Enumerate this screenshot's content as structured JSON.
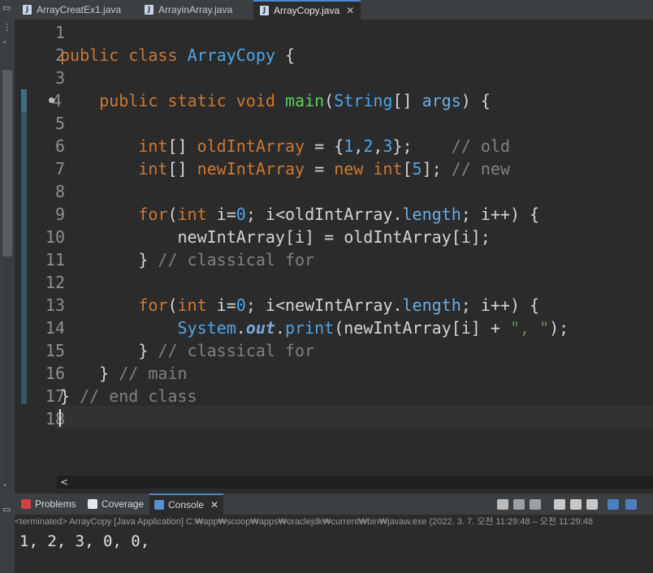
{
  "tabs": [
    {
      "label": "ArrayCreatEx1.java",
      "icon": "java-file-icon",
      "active": false
    },
    {
      "label": "ArrayinArray.java",
      "icon": "java-file-icon",
      "active": false
    },
    {
      "label": "ArrayCopy.java",
      "icon": "java-file-icon",
      "active": true,
      "close": "✕"
    }
  ],
  "editor": {
    "line_numbers": [
      "1",
      "2",
      "3",
      "4",
      "5",
      "6",
      "7",
      "8",
      "9",
      "10",
      "11",
      "12",
      "13",
      "14",
      "15",
      "16",
      "17",
      "18"
    ],
    "lines": {
      "l2": {
        "kw1": "public",
        "kw2": "class",
        "name": "ArrayCopy",
        "brace": "{"
      },
      "l4": {
        "kw1": "public",
        "kw2": "static",
        "kw3": "void",
        "fn": "main",
        "p1": "(",
        "type": "String",
        "arr": "[]",
        "arg": "args",
        "p2": ")",
        "brace": "{"
      },
      "l6": {
        "type": "int",
        "arr": "[]",
        "name": "oldIntArray",
        "eq": "=",
        "lb": "{",
        "n1": "1",
        "c1": ",",
        "n2": "2",
        "c2": ",",
        "n3": "3",
        "rb": "};",
        "comment": "// old"
      },
      "l7": {
        "type": "int",
        "arr": "[]",
        "name": "newIntArray",
        "eq": "=",
        "kw": "new",
        "type2": "int",
        "lbr": "[",
        "n": "5",
        "rbr": "];",
        "comment": "// new"
      },
      "l9": {
        "kw": "for",
        "p1": "(",
        "type": "int",
        "v": "i",
        "eq": "=",
        "n0": "0",
        "semi": ";",
        "cond1": "i<oldIntArray.",
        "field": "length",
        "semi2": ";",
        "inc": "i++",
        "p2": ")",
        "brace": "{"
      },
      "l10": {
        "text": "newIntArray[i] = oldIntArray[i];"
      },
      "l11": {
        "brace": "}",
        "comment": "// classical for"
      },
      "l13": {
        "kw": "for",
        "p1": "(",
        "type": "int",
        "v": "i",
        "eq": "=",
        "n0": "0",
        "semi": ";",
        "cond1": "i<newIntArray.",
        "field": "length",
        "semi2": ";",
        "inc": "i++",
        "p2": ")",
        "brace": "{"
      },
      "l14": {
        "sys": "System",
        "dot1": ".",
        "out": "out",
        "dot2": ".",
        "fn": "print",
        "args": "(newIntArray[i] + ",
        "str": "\", \"",
        "end": ");"
      },
      "l15": {
        "brace": "}",
        "comment": "// classical for"
      },
      "l16": {
        "brace": "}",
        "comment": "// main"
      },
      "l17": {
        "brace": "}",
        "comment": "// end class"
      }
    }
  },
  "panel": {
    "tabs": [
      {
        "label": "Problems",
        "icon": "problems-icon",
        "active": false
      },
      {
        "label": "Coverage",
        "icon": "coverage-icon",
        "active": false
      },
      {
        "label": "Console",
        "icon": "console-icon",
        "active": true,
        "close": "✕"
      }
    ],
    "status": "<terminated> ArrayCopy [Java Application] C:₩app₩scoop₩apps₩oraclejdk₩current₩bin₩javaw.exe  (2022. 3. 7. 오전 11:29:48 – 오전 11:29:48",
    "output": "1, 2, 3, 0, 0,"
  },
  "colors": {
    "keyword": "#cc7832",
    "class": "#4ea6e8",
    "method": "#5dd05d",
    "string": "#6a8759",
    "comment": "#808080",
    "accent": "#4a88c7"
  }
}
